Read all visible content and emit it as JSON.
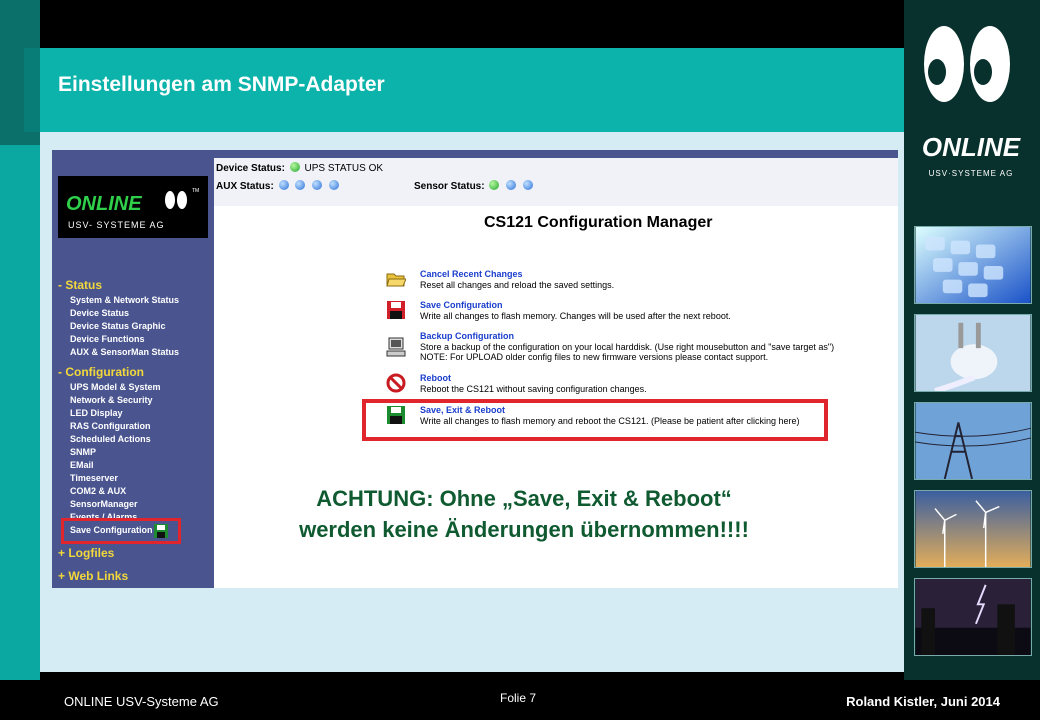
{
  "slide": {
    "title": "Einstellungen am SNMP-Adapter",
    "footer_left": "ONLINE  USV-Systeme AG",
    "footer_center": "Folie 7",
    "footer_right": "Roland Kistler, Juni 2014"
  },
  "brand": {
    "logo_text": "ONLINE",
    "logo_sub": "USV·SYSTEME AG",
    "sidebar_logo_text": "ONLINE",
    "sidebar_logo_sub": "USV- SYSTEME AG",
    "sidebar_logo_tm": "TM"
  },
  "status": {
    "device_label": "Device Status:",
    "device_value": "UPS STATUS OK",
    "aux_label": "AUX Status:",
    "sensor_label": "Sensor Status:"
  },
  "sidebar": {
    "status_section": "- Status",
    "status_items": [
      "System & Network Status",
      "Device Status",
      "Device Status Graphic",
      "Device Functions",
      "AUX & SensorMan Status"
    ],
    "config_section": "- Configuration",
    "config_items": [
      "UPS Model & System",
      "Network & Security",
      "LED Display",
      "RAS Configuration",
      "Scheduled Actions",
      "SNMP",
      "EMail",
      "Timeserver",
      "COM2 & AUX",
      "SensorManager",
      "Events / Alarms",
      "Save Configuration"
    ],
    "logfiles": "+ Logfiles",
    "weblinks": "+ Web Links"
  },
  "main": {
    "heading": "CS121 Configuration Manager",
    "actions": [
      {
        "title": "Cancel Recent Changes",
        "desc": "Reset all changes and reload the saved settings.",
        "desc2": "",
        "icon": "folder-icon"
      },
      {
        "title": "Save Configuration",
        "desc": "Write all changes to flash memory. Changes will be used after the next reboot.",
        "desc2": "",
        "icon": "floppy-red-icon"
      },
      {
        "title": "Backup Configuration",
        "desc": "Store a backup of the configuration on your local harddisk. (Use right mousebutton and \"save target as\")",
        "desc2": "NOTE: For UPLOAD older config files to new firmware versions please contact support.",
        "icon": "computer-icon"
      },
      {
        "title": "Reboot",
        "desc": "Reboot the CS121 without saving configuration changes.",
        "desc2": "",
        "icon": "no-entry-icon"
      },
      {
        "title": "Save, Exit & Reboot",
        "desc": "Write all changes to flash memory and reboot the CS121. (Please be patient after clicking here)",
        "desc2": "",
        "icon": "floppy-green-icon"
      }
    ]
  },
  "warning": {
    "line1": "ACHTUNG: Ohne „Save, Exit & Reboot“",
    "line2": "werden keine Änderungen übernommen!!!!"
  },
  "colors": {
    "teal": "#0bb3aa",
    "sidebar": "#4a5590",
    "highlight": "#e0262c",
    "warning_text": "#0f5a30"
  }
}
